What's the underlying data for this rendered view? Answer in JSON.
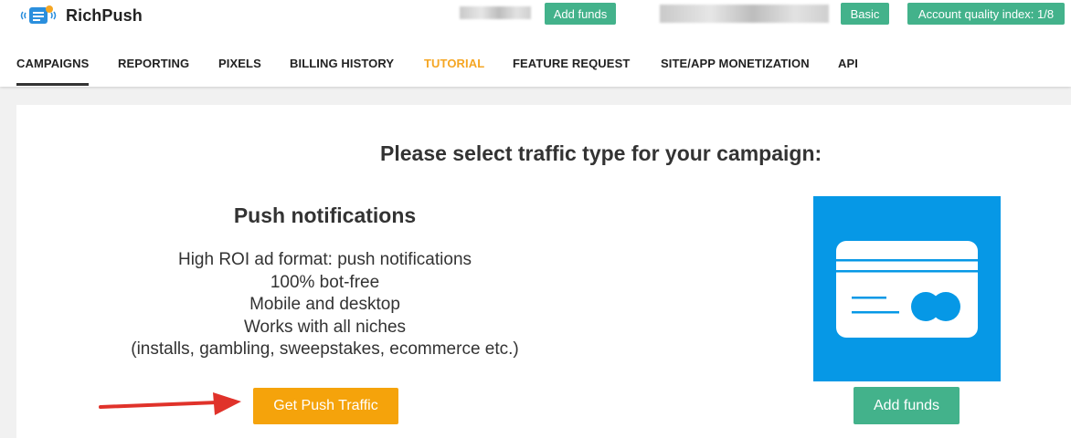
{
  "header": {
    "brand": "RichPush",
    "add_funds_label": "Add funds",
    "plan_label": "Basic",
    "quality_label": "Account quality index: 1/8"
  },
  "nav": {
    "items": [
      {
        "label": "CAMPAIGNS",
        "active": true
      },
      {
        "label": "REPORTING"
      },
      {
        "label": "PIXELS"
      },
      {
        "label": "BILLING HISTORY"
      },
      {
        "label": "TUTORIAL",
        "highlight": "#f5a623"
      },
      {
        "label": "FEATURE REQUEST"
      },
      {
        "label": "SITE/APP MONETIZATION"
      },
      {
        "label": "API"
      }
    ]
  },
  "main": {
    "headline": "Please select traffic type for your campaign:",
    "push": {
      "title": "Push notifications",
      "features": [
        "High ROI ad format: push notifications",
        "100% bot-free",
        "Mobile and desktop",
        "Works with all niches",
        "(installs, gambling, sweepstakes, ecommerce etc.)"
      ],
      "cta_label": "Get Push Traffic"
    },
    "billing": {
      "icon": "credit-card-icon",
      "cta_label": "Add funds"
    }
  },
  "colors": {
    "accent_green": "#43b28b",
    "accent_orange": "#f5a30b",
    "tutorial_orange": "#f5a623",
    "card_blue": "#0698e6",
    "arrow_red": "#e0322a"
  }
}
